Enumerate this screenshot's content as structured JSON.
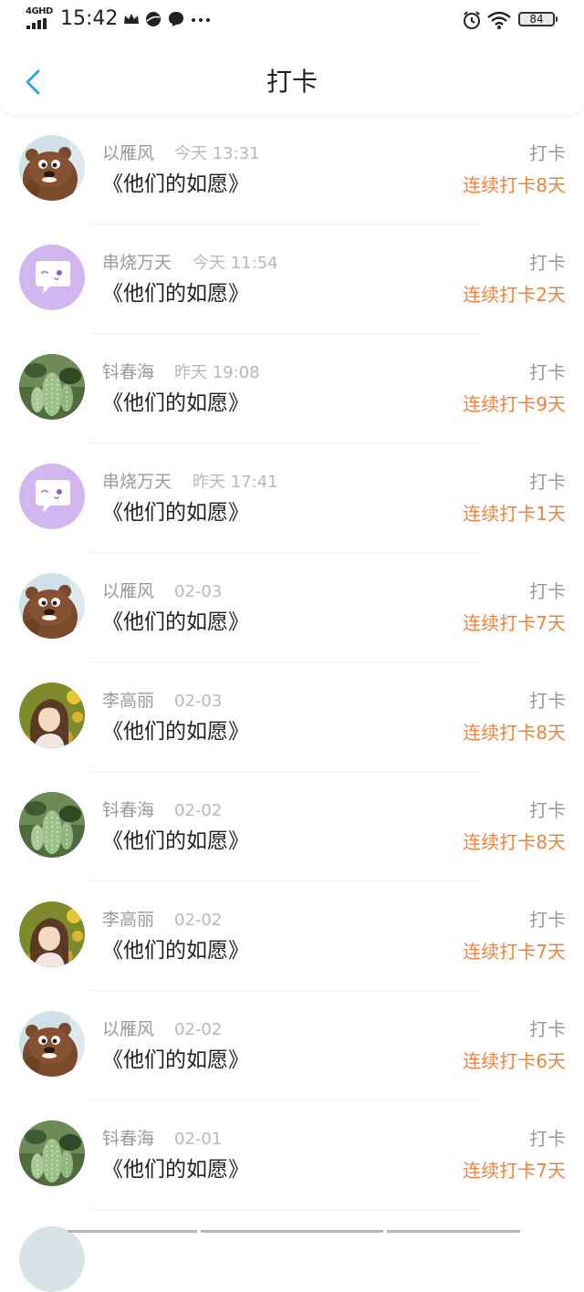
{
  "status_bar": {
    "network": "4GHD",
    "time": "15:42",
    "battery": "84"
  },
  "nav": {
    "title": "打卡"
  },
  "colors": {
    "accent_blue": "#2ea7e8",
    "streak_orange": "#f0823a",
    "muted_text": "#9a9a9a"
  },
  "items": [
    {
      "name": "以雁风",
      "time": "今天 13:31",
      "book": "《他们的如愿》",
      "type": "打卡",
      "streak": "连续打卡8天",
      "avatar": "bear-avatar"
    },
    {
      "name": "串烧万天",
      "time": "今天 11:54",
      "book": "《他们的如愿》",
      "type": "打卡",
      "streak": "连续打卡2天",
      "avatar": "chat-bubble-avatar"
    },
    {
      "name": "钭春海",
      "time": "昨天 19:08",
      "book": "《他们的如愿》",
      "type": "打卡",
      "streak": "连续打卡9天",
      "avatar": "cactus-avatar"
    },
    {
      "name": "串烧万天",
      "time": "昨天 17:41",
      "book": "《他们的如愿》",
      "type": "打卡",
      "streak": "连续打卡1天",
      "avatar": "chat-bubble-avatar"
    },
    {
      "name": "以雁风",
      "time": "02-03",
      "book": "《他们的如愿》",
      "type": "打卡",
      "streak": "连续打卡7天",
      "avatar": "bear-avatar"
    },
    {
      "name": "李高丽",
      "time": "02-03",
      "book": "《他们的如愿》",
      "type": "打卡",
      "streak": "连续打卡8天",
      "avatar": "girl-photo-avatar"
    },
    {
      "name": "钭春海",
      "time": "02-02",
      "book": "《他们的如愿》",
      "type": "打卡",
      "streak": "连续打卡8天",
      "avatar": "cactus-avatar"
    },
    {
      "name": "李高丽",
      "time": "02-02",
      "book": "《他们的如愿》",
      "type": "打卡",
      "streak": "连续打卡7天",
      "avatar": "girl-photo-avatar"
    },
    {
      "name": "以雁风",
      "time": "02-02",
      "book": "《他们的如愿》",
      "type": "打卡",
      "streak": "连续打卡6天",
      "avatar": "bear-avatar"
    },
    {
      "name": "钭春海",
      "time": "02-01",
      "book": "《他们的如愿》",
      "type": "打卡",
      "streak": "连续打卡7天",
      "avatar": "cactus-avatar"
    }
  ]
}
